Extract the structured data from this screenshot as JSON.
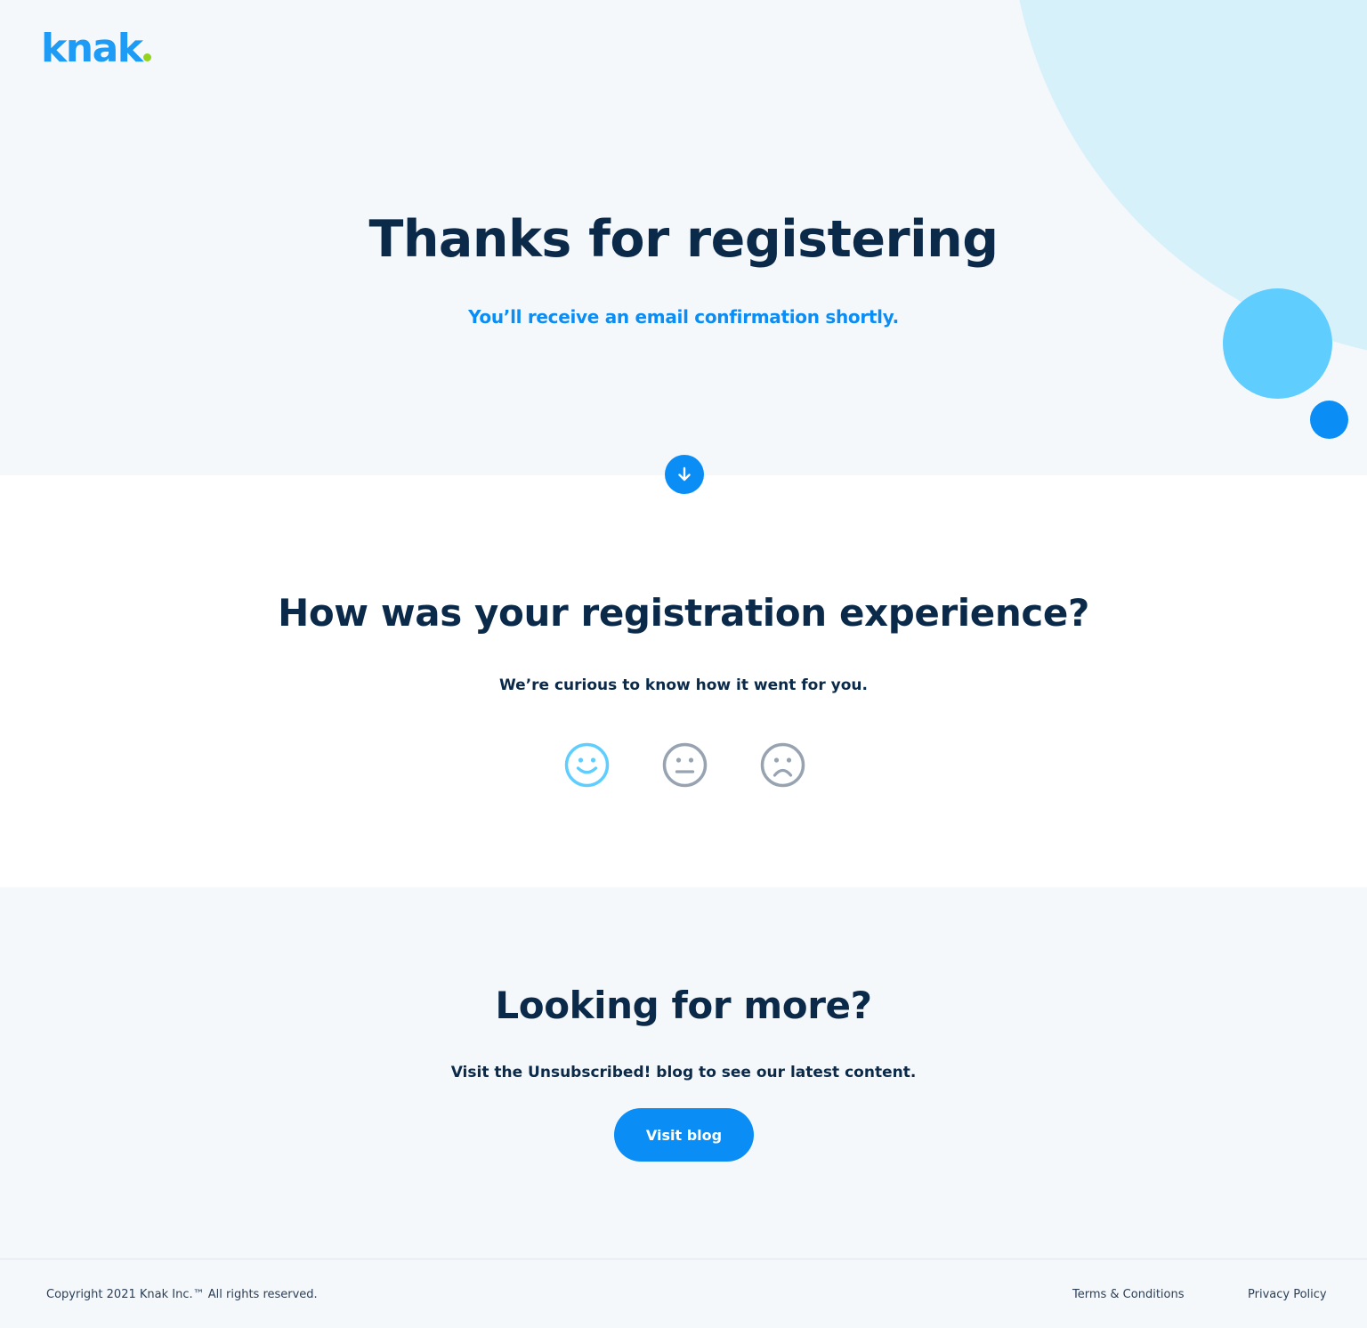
{
  "brand": {
    "logo_text": "knak",
    "colors": {
      "primary_blue": "#0a8ef5",
      "logo_blue": "#1e9bf5",
      "logo_dot_green": "#93d31c",
      "navy_text": "#0b2a4a",
      "light_cyan": "#60cdff",
      "pale_cyan": "#d7f1fb",
      "neutral_face_gray": "#97a3b1"
    }
  },
  "hero": {
    "title": "Thanks for registering",
    "subtitle": "You’ll receive an email confirmation shortly.",
    "scroll_icon": "arrow-down-icon"
  },
  "feedback": {
    "title": "How was your registration experience?",
    "subtitle": "We’re curious to know how it went for you.",
    "options": [
      {
        "name": "happy",
        "icon": "smiley-happy-icon",
        "selected": true
      },
      {
        "name": "neutral",
        "icon": "smiley-neutral-icon",
        "selected": false
      },
      {
        "name": "sad",
        "icon": "smiley-sad-icon",
        "selected": false
      }
    ]
  },
  "more": {
    "title": "Looking for more?",
    "subtitle": "Visit the Unsubscribed! blog to see our latest content.",
    "button_label": "Visit blog"
  },
  "footer": {
    "copyright": "Copyright 2021 Knak Inc.™ All rights reserved.",
    "links": [
      {
        "label": "Terms & Conditions"
      },
      {
        "label": "Privacy Policy"
      }
    ]
  }
}
